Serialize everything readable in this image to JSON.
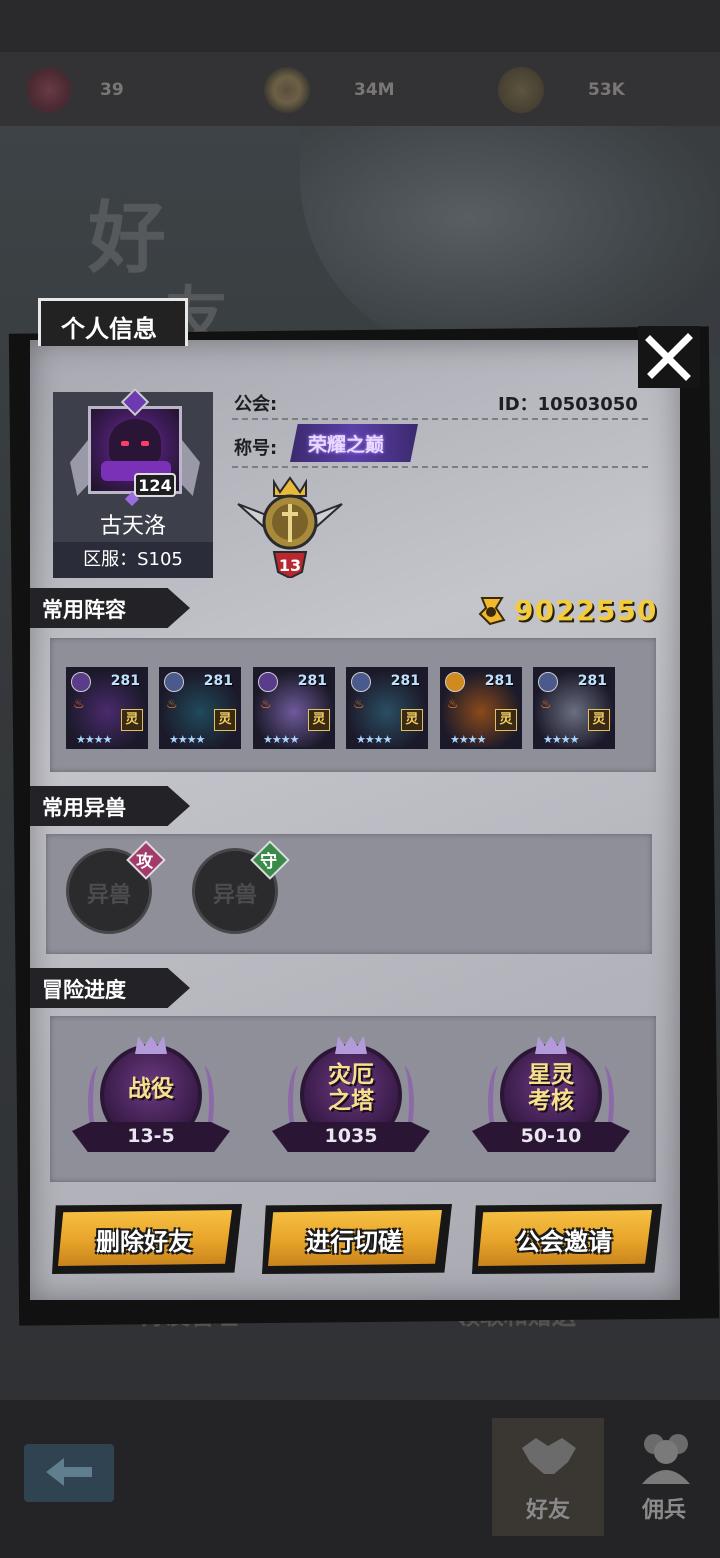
{
  "resources": [
    {
      "icon": "heart-icon",
      "value": "39"
    },
    {
      "icon": "coin-ring-icon",
      "value": "34M"
    },
    {
      "icon": "gold-pile-icon",
      "value": "53K"
    }
  ],
  "background": {
    "title_1": "好",
    "title_2": "友",
    "buttons": [
      "好友管理",
      "领取和赠送"
    ],
    "nav_tabs": [
      "好友",
      "佣兵"
    ]
  },
  "panel": {
    "tab_title": "个人信息",
    "player": {
      "level": "124",
      "name": "古天洛",
      "server": "区服：S105",
      "guild_label": "公会:",
      "id": "ID：10503050",
      "title_label": "称号:",
      "title_badge": "荣耀之巅",
      "rank": "13"
    },
    "gold": "9022550",
    "sections": {
      "lineup": "常用阵容",
      "beasts": "常用异兽",
      "progress": "冒险进度"
    },
    "heroes": [
      {
        "level": "281",
        "element": "dark",
        "tag": "灵",
        "stars": "★★★★",
        "color": "#4a2a6e"
      },
      {
        "level": "281",
        "element": "water",
        "tag": "灵",
        "stars": "★★★★",
        "color": "#1f4a5a"
      },
      {
        "level": "281",
        "element": "dark",
        "tag": "灵",
        "stars": "★★★★",
        "color": "#6e5a9a"
      },
      {
        "level": "281",
        "element": "water",
        "tag": "灵",
        "stars": "★★★★",
        "color": "#2a4e63"
      },
      {
        "level": "281",
        "element": "sun",
        "tag": "灵",
        "stars": "★★★★",
        "color": "#8a4a1a"
      },
      {
        "level": "281",
        "element": "water",
        "tag": "灵",
        "stars": "★★★★",
        "color": "#6a6f80"
      }
    ],
    "beasts": [
      {
        "label": "异兽",
        "tag": "攻",
        "tag_color": "#a23a6a"
      },
      {
        "label": "异兽",
        "tag": "守",
        "tag_color": "#3a8a4a"
      }
    ],
    "adventures": [
      {
        "name": "战役",
        "value": "13-5"
      },
      {
        "name": "灾厄\n之塔",
        "value": "1035"
      },
      {
        "name": "星灵\n考核",
        "value": "50-10"
      }
    ],
    "buttons": {
      "delete": "删除好友",
      "duel": "进行切磋",
      "invite": "公会邀请"
    }
  }
}
